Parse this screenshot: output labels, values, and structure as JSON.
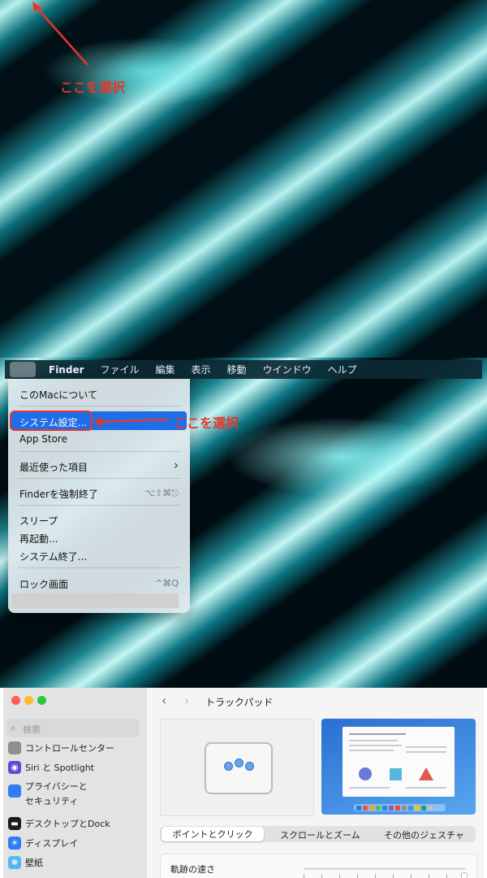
{
  "annotations": {
    "top": "ここを選択",
    "menu": "ここを選択"
  },
  "menubar": {
    "apple_icon": "apple-logo-icon",
    "items": [
      "Finder",
      "ファイル",
      "編集",
      "表示",
      "移動",
      "ウインドウ",
      "ヘルプ"
    ]
  },
  "apple_menu": {
    "items": [
      {
        "label": "このMacについて"
      },
      {
        "label": "システム設定..."
      },
      {
        "label": "App Store"
      },
      {
        "label": "最近使った項目",
        "shortcut": "›"
      },
      {
        "label": "Finderを強制終了",
        "shortcut": "⌥⇧⌘⎋"
      },
      {
        "label": "スリープ"
      },
      {
        "label": "再起動..."
      },
      {
        "label": "システム終了..."
      },
      {
        "label": "ロック画面",
        "shortcut": "^⌘Q"
      }
    ]
  },
  "settings": {
    "traffic_lights": [
      "#fe5f57",
      "#febc2e",
      "#28c840"
    ],
    "search_placeholder": "検索",
    "sidebar": [
      {
        "label": "コントロールセンター",
        "icon": "control-center-icon",
        "color": "#8e8e93"
      },
      {
        "label": "Siri と Spotlight",
        "icon": "siri-icon",
        "color": "#5a4fcf"
      },
      {
        "label": "プライバシーと",
        "label2": "セキュリティ",
        "icon": "hand-icon",
        "color": "#2f7cf6"
      },
      {
        "label": "デスクトップとDock",
        "icon": "desktop-icon",
        "color": "#1c1c1e"
      },
      {
        "label": "ディスプレイ",
        "icon": "display-icon",
        "color": "#2f7cf6"
      },
      {
        "label": "壁紙",
        "icon": "wallpaper-icon",
        "color": "#52b8f4"
      }
    ],
    "title": "トラックパッド",
    "tabs": [
      "ポイントとクリック",
      "スクロールとズーム",
      "その他のジェスチャ"
    ],
    "active_tab": 0,
    "tracking_label": "軌跡の速さ"
  }
}
